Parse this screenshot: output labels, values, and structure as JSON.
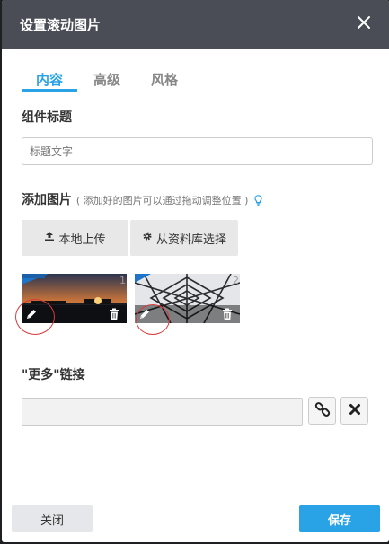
{
  "dialog": {
    "title": "设置滚动图片",
    "close_icon": "close-icon"
  },
  "tabs": [
    {
      "label": "内容",
      "active": true
    },
    {
      "label": "高级",
      "active": false
    },
    {
      "label": "风格",
      "active": false
    }
  ],
  "component_title": {
    "label": "组件标题",
    "placeholder": "标题文字",
    "value": ""
  },
  "add_images": {
    "label": "添加图片",
    "hint": "( 添加好的图片可以通过拖动调整位置 )",
    "hint_icon": "lightbulb-icon",
    "upload_local_label": "本地上传",
    "upload_local_icon": "upload-icon",
    "from_library_label": "从资料库选择",
    "from_library_icon": "gear-icon",
    "images": [
      {
        "index": "1",
        "description": "sunset-harbor",
        "edit_icon": "pencil-icon",
        "delete_icon": "trash-icon"
      },
      {
        "index": "2",
        "description": "geometric-structure",
        "edit_icon": "pencil-icon",
        "delete_icon": "trash-icon"
      }
    ]
  },
  "more_link": {
    "label": "\"更多\"链接",
    "value": "",
    "link_icon": "link-icon",
    "clear_icon": "close-icon"
  },
  "footer": {
    "close_label": "关闭",
    "save_label": "保存"
  },
  "colors": {
    "accent": "#2aa3e6",
    "titlebar": "#4a4d55",
    "annotation_circle": "#d93a3a"
  }
}
